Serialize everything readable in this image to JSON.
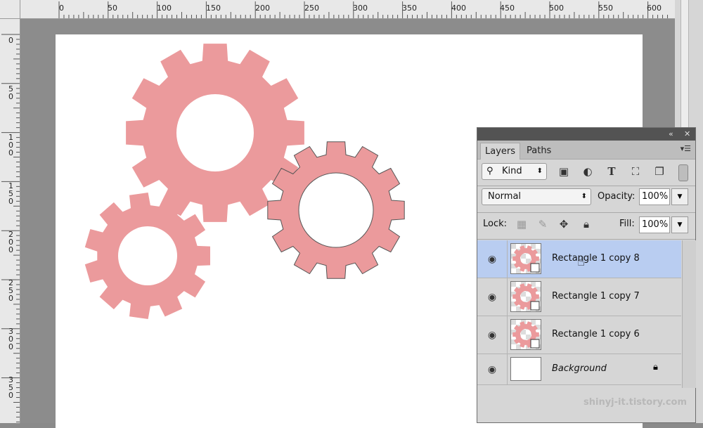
{
  "rulers": {
    "horizontal_ticks": [
      "0",
      "50",
      "100",
      "150",
      "200",
      "250",
      "300",
      "350",
      "400",
      "450",
      "500",
      "550",
      "600"
    ],
    "vertical_ticks": [
      "0",
      "50",
      "100",
      "150",
      "200",
      "250",
      "300",
      "350"
    ]
  },
  "colors": {
    "gear": "#eb9a9c",
    "selection": "#b9cdf1"
  },
  "layers_panel": {
    "collapse_icon": "double-chevron-left-icon",
    "close_icon": "close-icon",
    "tabs": [
      {
        "label": "Layers",
        "active": true
      },
      {
        "label": "Paths",
        "active": false
      }
    ],
    "filter": {
      "kind_label": "Kind",
      "icons": [
        "image-filter-icon",
        "adjustment-filter-icon",
        "type-filter-icon",
        "shape-filter-icon",
        "smart-object-filter-icon"
      ]
    },
    "blend_mode": "Normal",
    "opacity_label": "Opacity:",
    "opacity_value": "100%",
    "lock_label": "Lock:",
    "fill_label": "Fill:",
    "fill_value": "100%",
    "layers": [
      {
        "name": "Rectangle 1 copy 8",
        "selected": true
      },
      {
        "name": "Rectangle 1 copy 7",
        "selected": false
      },
      {
        "name": "Rectangle 1 copy 6",
        "selected": false
      },
      {
        "name": "Background",
        "selected": false,
        "locked": true
      }
    ]
  },
  "watermark": "shinyj-it.tistory.com"
}
